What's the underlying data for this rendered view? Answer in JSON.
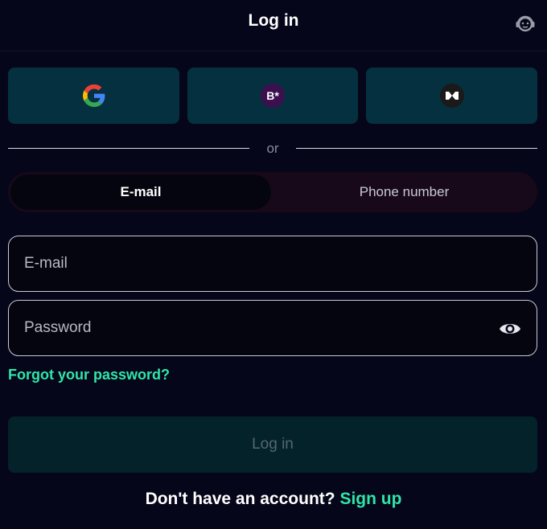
{
  "header": {
    "title": "Log in",
    "support_icon": "headset-icon"
  },
  "social": {
    "buttons": [
      {
        "icon": "google-icon",
        "text": ""
      },
      {
        "icon": "bstar-icon",
        "text": "B*"
      },
      {
        "icon": "mono-logo-icon",
        "text": ""
      }
    ]
  },
  "divider": {
    "text": "or"
  },
  "method_toggle": {
    "options": [
      "E-mail",
      "Phone number"
    ],
    "selected": "E-mail"
  },
  "form": {
    "email_placeholder": "E-mail",
    "email_value": "",
    "password_placeholder": "Password",
    "password_value": "",
    "password_toggle_icon": "eye-icon",
    "forgot_label": "Forgot your password?",
    "submit_label": "Log in"
  },
  "footer": {
    "prompt": "Don't have an account?",
    "signup_label": "Sign up"
  },
  "colors": {
    "background": "#06061a",
    "accent": "#2ee6a8",
    "social_button": "#05303f",
    "submit_disabled": "#04222a"
  }
}
